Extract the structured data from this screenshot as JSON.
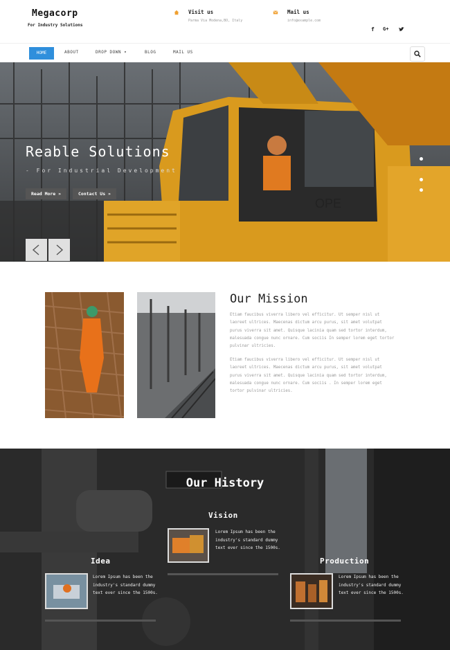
{
  "header": {
    "logo": "Megacorp",
    "tagline": "For Industry Solutions",
    "visit": {
      "title": "Visit us",
      "address": "Parma Via Modena,BO, Italy"
    },
    "mail": {
      "title": "Mail us",
      "email": "info@example.com"
    },
    "social": [
      "f",
      "G+",
      "twitter"
    ]
  },
  "nav": {
    "items": [
      "HOME",
      "ABOUT",
      "DROP DOWN ▾",
      "BLOG",
      "MAIL US"
    ],
    "active": "HOME"
  },
  "hero": {
    "title": "Reable Solutions",
    "subtitle": "- For Industrial Development",
    "read_more": "Read More »",
    "contact_us": "Contact Us »",
    "slides": 4,
    "active_slide": 2
  },
  "mission": {
    "title": "Our Mission",
    "p1": "Etiam faucibus viverra libero vel efficitur. Ut semper nisl ut laoreet ultrices. Maecenas dictum arcu purus, sit amet volutpat purus viverra sit amet. Quisque lacinia quam sed tortor interdum, malesuada congue nunc ornare. Cum sociis In semper lorem eget tortor pulvinar ultricies.",
    "p2": "Etiam faucibus viverra libero vel efficitur. Ut semper nisl ut laoreet ultrices. Maecenas dictum arcu purus, sit amet volutpat purus viverra sit amet. Quisque lacinia quam sed tortor interdum, malesuada congue nunc ornare. Cum sociis . In semper lorem eget tortor pulvinar ultricies."
  },
  "history": {
    "title": "Our History",
    "vision": {
      "heading": "Vision",
      "text": "Lorem Ipsum has been the industry's standard dummy text ever since the 1500s."
    },
    "idea": {
      "heading": "Idea",
      "text": "Lorem Ipsum has been the industry's standard dummy text ever since the 1500s."
    },
    "production": {
      "heading": "Production",
      "text": "Lorem Ipsum has been the industry's standard dummy text ever since the 1500s."
    }
  },
  "colors": {
    "accent": "#2f8fdc",
    "orange": "#f0a030",
    "dark": "#2b2b2b"
  }
}
